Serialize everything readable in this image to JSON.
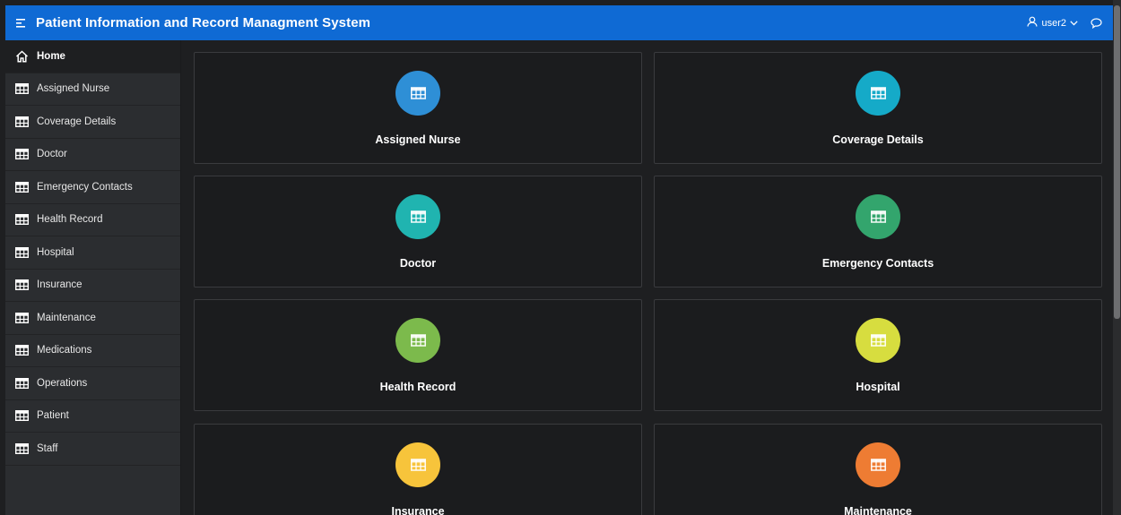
{
  "header": {
    "title": "Patient Information and Record Managment System",
    "menu_icon": "hamburger-icon",
    "user_label": "user2",
    "user_icon": "user-icon",
    "dropdown_icon": "chevron-down-icon",
    "chat_icon": "chat-icon",
    "bar_color": "#0f6ad4"
  },
  "sidebar": {
    "items": [
      {
        "label": "Home",
        "icon": "home-icon",
        "active": true
      },
      {
        "label": "Assigned Nurse",
        "icon": "table-icon"
      },
      {
        "label": "Coverage Details",
        "icon": "table-icon"
      },
      {
        "label": "Doctor",
        "icon": "table-icon"
      },
      {
        "label": "Emergency Contacts",
        "icon": "table-icon"
      },
      {
        "label": "Health Record",
        "icon": "table-icon"
      },
      {
        "label": "Hospital",
        "icon": "table-icon"
      },
      {
        "label": "Insurance",
        "icon": "table-icon"
      },
      {
        "label": "Maintenance",
        "icon": "table-icon"
      },
      {
        "label": "Medications",
        "icon": "table-icon"
      },
      {
        "label": "Operations",
        "icon": "table-icon"
      },
      {
        "label": "Patient",
        "icon": "table-icon"
      },
      {
        "label": "Staff",
        "icon": "table-icon"
      }
    ]
  },
  "cards": [
    {
      "label": "Assigned Nurse",
      "icon": "table-icon",
      "color": "#2e8fd6"
    },
    {
      "label": "Coverage Details",
      "icon": "table-icon",
      "color": "#15aac8"
    },
    {
      "label": "Doctor",
      "icon": "table-icon",
      "color": "#20b4b0"
    },
    {
      "label": "Emergency Contacts",
      "icon": "table-icon",
      "color": "#33a56d"
    },
    {
      "label": "Health Record",
      "icon": "table-icon",
      "color": "#7cba4c"
    },
    {
      "label": "Hospital",
      "icon": "table-icon",
      "color": "#d7dd3f"
    },
    {
      "label": "Insurance",
      "icon": "table-icon",
      "color": "#f7c43b"
    },
    {
      "label": "Maintenance",
      "icon": "table-icon",
      "color": "#ee7c33"
    }
  ]
}
